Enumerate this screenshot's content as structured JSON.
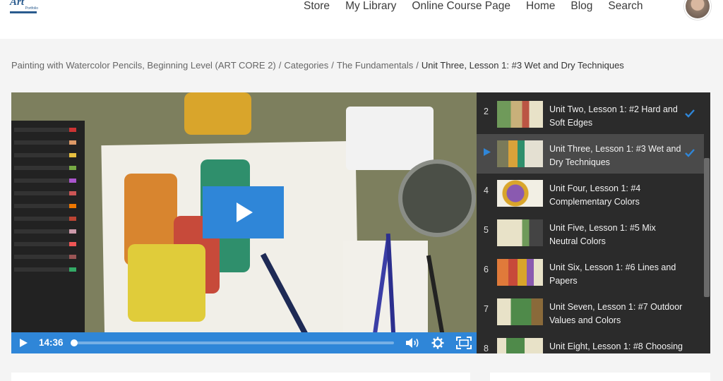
{
  "header": {
    "logo": {
      "text": "Art",
      "sub": "Portfolio",
      "alt": "site-logo"
    },
    "nav": [
      "Store",
      "My Library",
      "Online Course Page",
      "Home",
      "Blog",
      "Search"
    ],
    "avatar_icon": "user-avatar"
  },
  "breadcrumb": {
    "items": [
      "Painting with Watercolor Pencils, Beginning Level (ART CORE 2)",
      "Categories",
      "The Fundamentals"
    ],
    "separator": "/",
    "current": "Unit Three, Lesson 1: #3 Wet and Dry Techniques"
  },
  "player": {
    "time": "14:36",
    "progress": 0.0,
    "accent": "#2f86d8",
    "icons": [
      "play-icon",
      "volume-icon",
      "settings-gear-icon",
      "fullscreen-icon"
    ]
  },
  "playlist": {
    "items": [
      {
        "num": "2",
        "title": "Unit Two, Lesson 1: #2 Hard and Soft Edges",
        "completed": true,
        "active": false
      },
      {
        "num": "",
        "title": "Unit Three, Lesson 1: #3 Wet and Dry Techniques",
        "completed": true,
        "active": true
      },
      {
        "num": "4",
        "title": "Unit Four, Lesson 1: #4 Complementary Colors",
        "completed": false,
        "active": false
      },
      {
        "num": "5",
        "title": "Unit Five, Lesson 1: #5 Mix Neutral Colors",
        "completed": false,
        "active": false
      },
      {
        "num": "6",
        "title": "Unit Six, Lesson 1: #6 Lines and Papers",
        "completed": false,
        "active": false
      },
      {
        "num": "7",
        "title": "Unit Seven, Lesson 1: #7 Outdoor Values and Colors",
        "completed": false,
        "active": false
      },
      {
        "num": "8",
        "title": "Unit Eight, Lesson 1: #8 Choosing",
        "completed": false,
        "active": false
      }
    ],
    "check_color": "#2f86d8"
  }
}
